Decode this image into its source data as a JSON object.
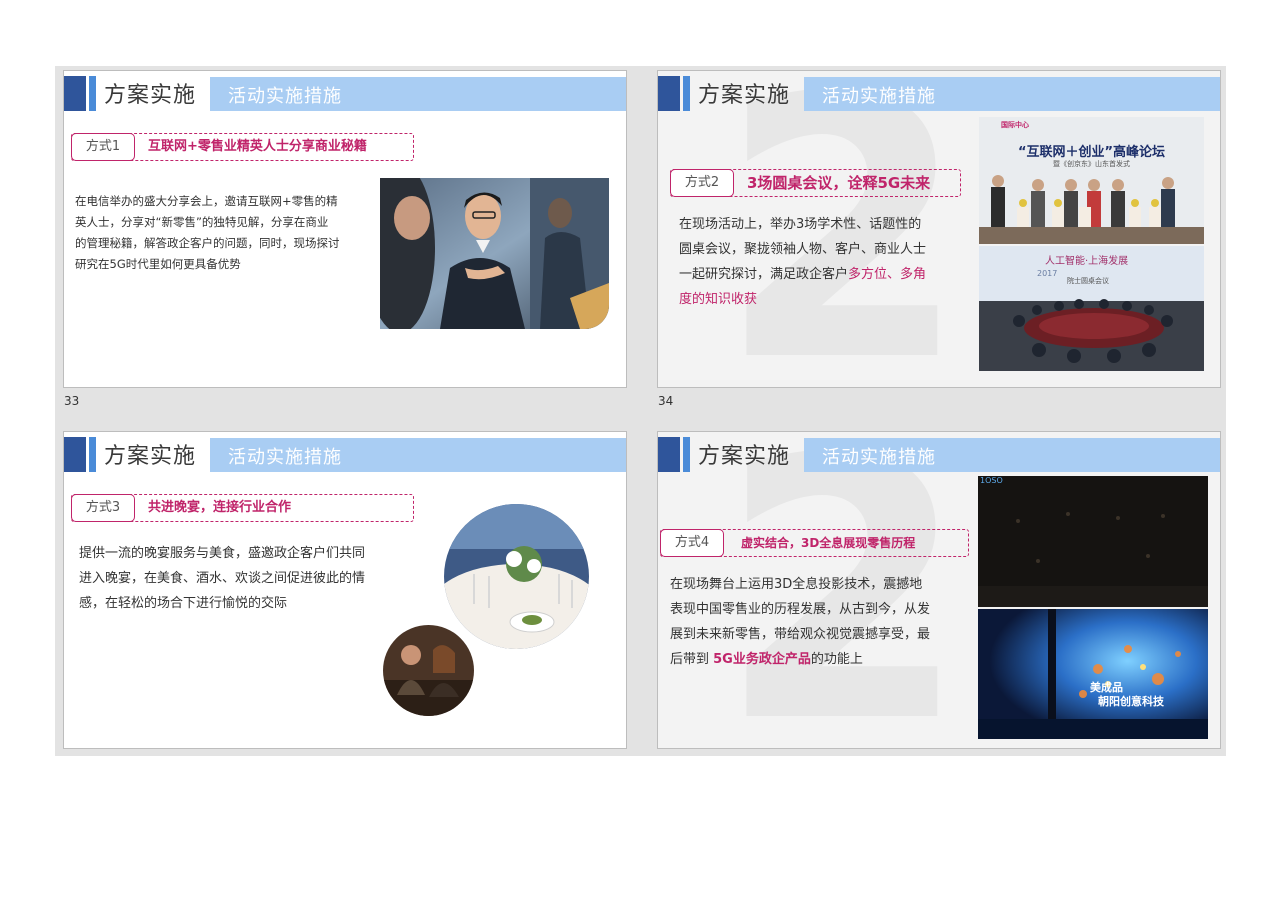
{
  "header": {
    "title": "方案实施",
    "subtitle": "活动实施措施"
  },
  "slides": [
    {
      "page": "33",
      "tag_label": "方式1",
      "tag_text": "互联网+零售业精英人士分享商业秘籍",
      "body": [
        "在电信举办的盛大分享会上，邀请互联网+零售的精",
        "英人士，分享对“新零售”的独特见解，分享在商业",
        "的管理秘籍，解答政企客户的问题，同时，现场探讨",
        "研究在5G时代里如何更具备优势"
      ]
    },
    {
      "page": "34",
      "tag_label": "方式2",
      "tag_text": "3场圆桌会议，诠释5G未来",
      "body": [
        "在现场活动上，举办3场学术性、话题性的",
        "圆桌会议，聚拢领袖人物、客户、商业人士",
        "一起研究探讨，满足政企客户"
      ],
      "body_highlight_1": "多方位、多角",
      "body_highlight_2": "度的知识收获",
      "photo_top": {
        "logo": "国际中心",
        "headline": "“互联网＋创业”高峰论坛",
        "subline": "暨《创京东》山东首发式"
      },
      "photo_bottom": {
        "screen_title": "人工智能·上海发展",
        "screen_year": "2017",
        "screen_sub": "院士圆桌会议"
      }
    },
    {
      "tag_label": "方式3",
      "tag_text": "共进晚宴，连接行业合作",
      "body": [
        "提供一流的晚宴服务与美食，盛邀政企客户们共同",
        "进入晚宴，在美食、酒水、欢谈之间促进彼此的情",
        "感，在轻松的场合下进行愉悦的交际"
      ]
    },
    {
      "tag_label": "方式4",
      "tag_text": "虚实结合，3D全息展现零售历程",
      "body": [
        "在现场舞台上运用3D全息投影技术，震撼地",
        "表现中国零售业的历程发展，从古到今，从发",
        "展到未来新零售，带给观众视觉震撼享受，最"
      ],
      "body_last_prefix": "后带到 ",
      "body_last_highlight": "5G业务政企产品",
      "body_last_suffix": "的功能上",
      "photo_top_mark": "1OSO",
      "photo_bottom_text_1": "美成品",
      "photo_bottom_text_2": "朝阳创意科技"
    }
  ],
  "colors": {
    "accent": "#c0246a",
    "header_dark": "#2f559b",
    "header_mid": "#4a8bd8",
    "header_band": "#a9cdf3"
  }
}
